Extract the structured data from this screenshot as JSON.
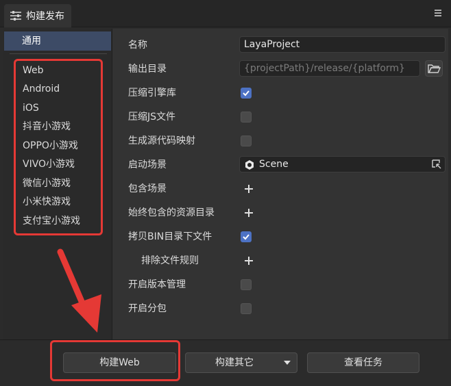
{
  "window": {
    "tab_title": "构建发布",
    "tab_icon": "sliders-icon",
    "menu_icon": "hamburger-menu-icon"
  },
  "sidebar": {
    "general_label": "通用",
    "platforms": [
      "Web",
      "Android",
      "iOS",
      "抖音小游戏",
      "OPPO小游戏",
      "VIVO小游戏",
      "微信小游戏",
      "小米快游戏",
      "支付宝小游戏"
    ]
  },
  "settings": {
    "name_label": "名称",
    "name_value": "LayaProject",
    "output_label": "输出目录",
    "output_placeholder": "{projectPath}/release/{platform}",
    "compress_engine_label": "压缩引擎库",
    "compress_engine_checked": true,
    "compress_js_label": "压缩JS文件",
    "compress_js_checked": false,
    "sourcemap_label": "生成源代码映射",
    "sourcemap_checked": false,
    "start_scene_label": "启动场景",
    "start_scene_value": "Scene",
    "include_scenes_label": "包含场景",
    "always_include_label": "始终包含的资源目录",
    "copy_bin_label": "拷贝BIN目录下文件",
    "copy_bin_checked": true,
    "exclude_rules_label": "排除文件规则",
    "version_label": "开启版本管理",
    "version_checked": false,
    "subpackage_label": "开启分包",
    "subpackage_checked": false
  },
  "footer": {
    "build_web_label": "构建Web",
    "build_other_label": "构建其它",
    "view_tasks_label": "查看任务"
  },
  "colors": {
    "accent": "#4d72c4",
    "selection": "#3d4b66",
    "annotation": "#e53935"
  }
}
